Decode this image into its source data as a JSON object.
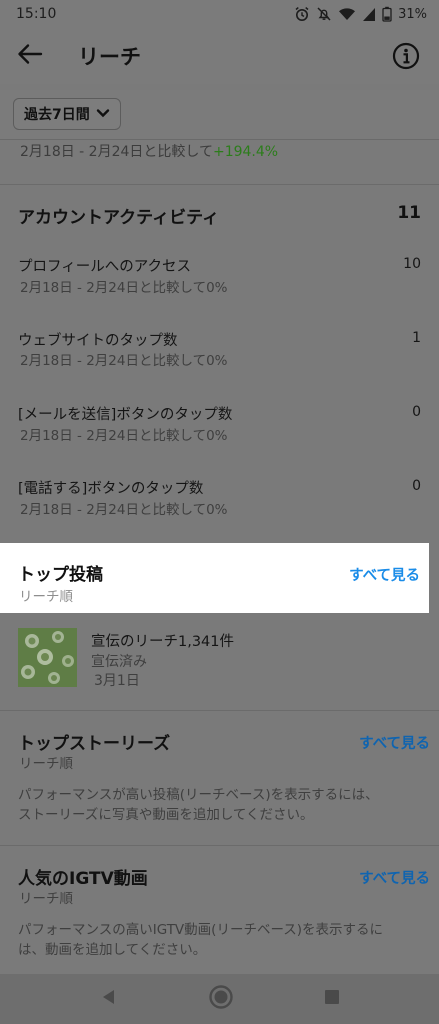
{
  "status_bar": {
    "time": "15:10",
    "battery": "31%",
    "icons": [
      "alarm-icon",
      "mute-icon",
      "wifi-icon",
      "signal-icon",
      "battery-icon"
    ]
  },
  "header": {
    "title": "リーチ",
    "back_icon": "arrow-left-icon",
    "info_icon": "info-icon"
  },
  "period": {
    "label": "過去7日間"
  },
  "top_compare": {
    "text": "2月18日 - 2月24日と比較して",
    "change": "+194.4%",
    "change_color": "#2c7d1b"
  },
  "account_activity": {
    "title": "アカウントアクティビティ",
    "total": "11",
    "metrics": [
      {
        "label": "プロフィールへのアクセス",
        "sub": "2月18日 - 2月24日と比較して0%",
        "value": "10"
      },
      {
        "label": "ウェブサイトのタップ数",
        "sub": "2月18日 - 2月24日と比較して0%",
        "value": "1"
      },
      {
        "label": "[メールを送信]ボタンのタップ数",
        "sub": "2月18日 - 2月24日と比較して0%",
        "value": "0"
      },
      {
        "label": "[電話する]ボタンのタップ数",
        "sub": "2月18日 - 2月24日と比較して0%",
        "value": "0"
      }
    ]
  },
  "top_posts": {
    "title": "トップ投稿",
    "sub": "リーチ順",
    "see_all": "すべて見る",
    "post": {
      "title": "宣伝のリーチ1,341件",
      "status": "宣伝済み",
      "date": "3月1日"
    }
  },
  "top_stories": {
    "title": "トップストーリーズ",
    "sub": "リーチ順",
    "see_all": "すべて見る",
    "desc_line1": "パフォーマンスが高い投稿(リーチベース)を表示するには、",
    "desc_line2": "ストーリーズに写真や動画を追加してください。"
  },
  "igtv": {
    "title": "人気のIGTV動画",
    "sub": "リーチ順",
    "see_all": "すべて見る",
    "desc_line1": "パフォーマンスの高いIGTV動画(リーチベース)を表示するに",
    "desc_line2": "は、動画を追加してください。"
  },
  "nav": {
    "icons": [
      "back-triangle-icon",
      "home-circle-icon",
      "recents-square-icon"
    ]
  },
  "colors": {
    "accent": "#1a8ce8",
    "dim_overlay": "#7b7b7b"
  }
}
